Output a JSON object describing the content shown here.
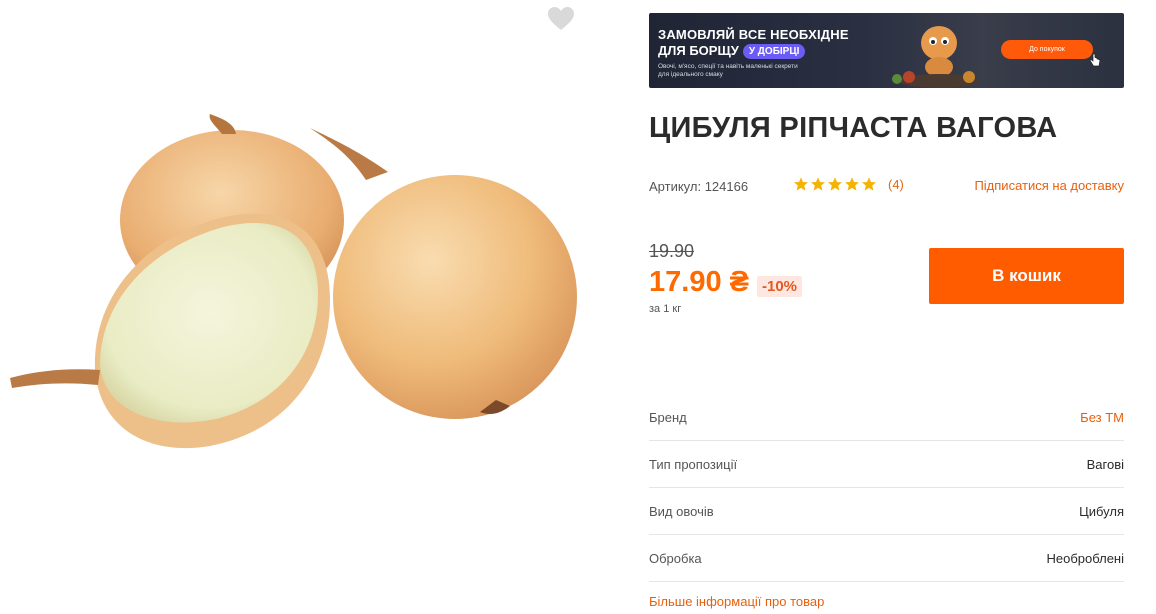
{
  "banner": {
    "line1": "ЗАМОВЛЯЙ ВСЕ НЕОБХІДНЕ",
    "line2": "ДЛЯ БОРЩУ",
    "pill": "У ДОБІРЦІ",
    "small": "Овочі, м'ясо, спеції та навіть маленькі секрети для ідеального смаку",
    "button": "До покупок"
  },
  "product": {
    "title": "ЦИБУЛЯ РІПЧАСТА ВАГОВА",
    "sku": "Артикул: 124166",
    "rating": {
      "stars": 5,
      "count": "(4)"
    },
    "subscribe": "Підписатися на доставку",
    "old_price": "19.90",
    "price": "17.90 ₴",
    "discount": "-10%",
    "unit": "за 1 кг",
    "cart_button": "В кошик"
  },
  "specs": [
    {
      "key": "Бренд",
      "value": "Без ТМ"
    },
    {
      "key": "Тип пропозиції",
      "value": "Вагові"
    },
    {
      "key": "Вид овочів",
      "value": "Цибуля"
    },
    {
      "key": "Обробка",
      "value": "Необроблені"
    }
  ],
  "more_info": "Більше інформації про товар",
  "colors": {
    "accent": "#ff5c00",
    "link": "#e8600e",
    "star": "#f5b301"
  }
}
